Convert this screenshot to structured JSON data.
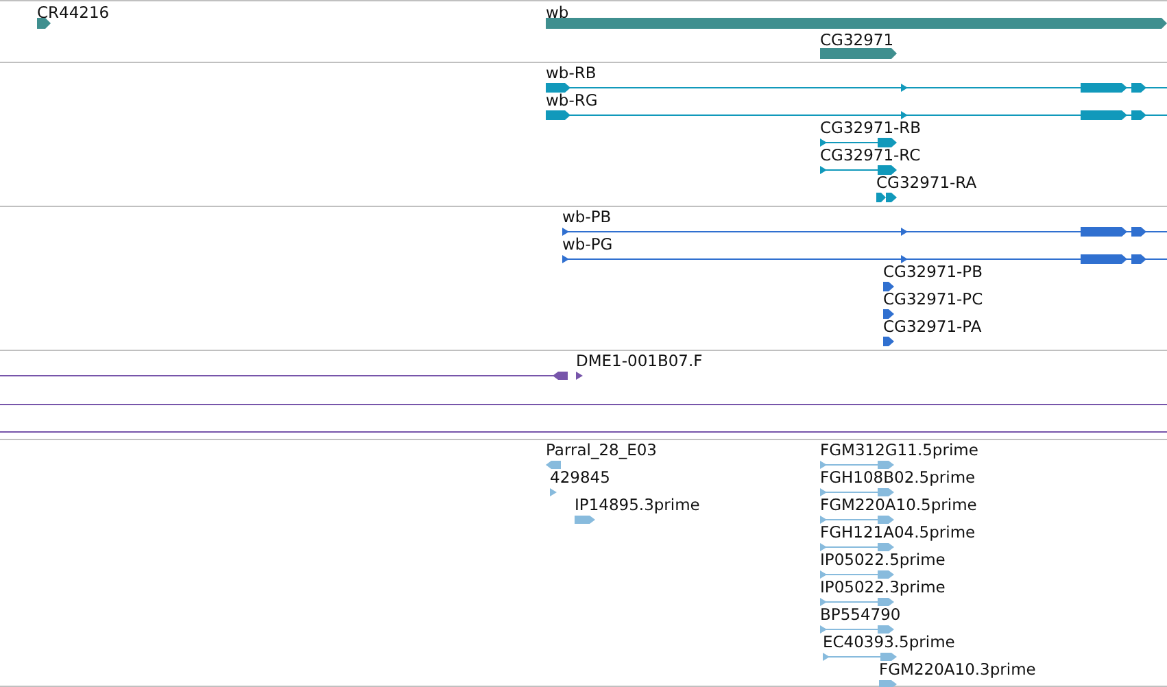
{
  "tracks": [
    {
      "color": "#3f8f8f",
      "features": [
        {
          "kind": "gene",
          "label": "CR44216",
          "reverse": false
        },
        {
          "kind": "gene",
          "label": "wb",
          "reverse": false
        },
        {
          "kind": "gene",
          "label": "CG32971",
          "reverse": false
        }
      ]
    },
    {
      "color": "#1199bb",
      "features": [
        {
          "kind": "transcript",
          "label": "wb-RB",
          "reverse": false
        },
        {
          "kind": "transcript",
          "label": "wb-RG",
          "reverse": false
        },
        {
          "kind": "transcript",
          "label": "CG32971-RB",
          "reverse": false
        },
        {
          "kind": "transcript",
          "label": "CG32971-RC",
          "reverse": false
        },
        {
          "kind": "transcript",
          "label": "CG32971-RA",
          "reverse": false
        }
      ]
    },
    {
      "color": "#3070d0",
      "features": [
        {
          "kind": "transcript",
          "label": "wb-PB",
          "reverse": false
        },
        {
          "kind": "transcript",
          "label": "wb-PG",
          "reverse": false
        },
        {
          "kind": "transcript",
          "label": "CG32971-PB",
          "reverse": false
        },
        {
          "kind": "transcript",
          "label": "CG32971-PC",
          "reverse": false
        },
        {
          "kind": "transcript",
          "label": "CG32971-PA",
          "reverse": false
        }
      ]
    },
    {
      "color": "#7755aa",
      "features": [
        {
          "kind": "match",
          "label": "DME1-001B07.F",
          "reverse": true
        },
        {
          "kind": "line"
        },
        {
          "kind": "line"
        }
      ]
    },
    {
      "color": "#88bbdd",
      "features": [
        {
          "kind": "match",
          "label": "Parral_28_E03",
          "reverse": true
        },
        {
          "kind": "match",
          "label": "FGM312G11.5prime",
          "reverse": false
        },
        {
          "kind": "match",
          "label": "429845",
          "reverse": false
        },
        {
          "kind": "match",
          "label": "FGH108B02.5prime",
          "reverse": false
        },
        {
          "kind": "match",
          "label": "IP14895.3prime",
          "reverse": false
        },
        {
          "kind": "match",
          "label": "FGM220A10.5prime",
          "reverse": false
        },
        {
          "kind": "match",
          "label": "FGH121A04.5prime",
          "reverse": false
        },
        {
          "kind": "match",
          "label": "IP05022.5prime",
          "reverse": false
        },
        {
          "kind": "match",
          "label": "IP05022.3prime",
          "reverse": false
        },
        {
          "kind": "match",
          "label": "BP554790",
          "reverse": false
        },
        {
          "kind": "match",
          "label": "EC40393.5prime",
          "reverse": false
        },
        {
          "kind": "match",
          "label": "FGM220A10.3prime",
          "reverse": false
        }
      ]
    }
  ]
}
